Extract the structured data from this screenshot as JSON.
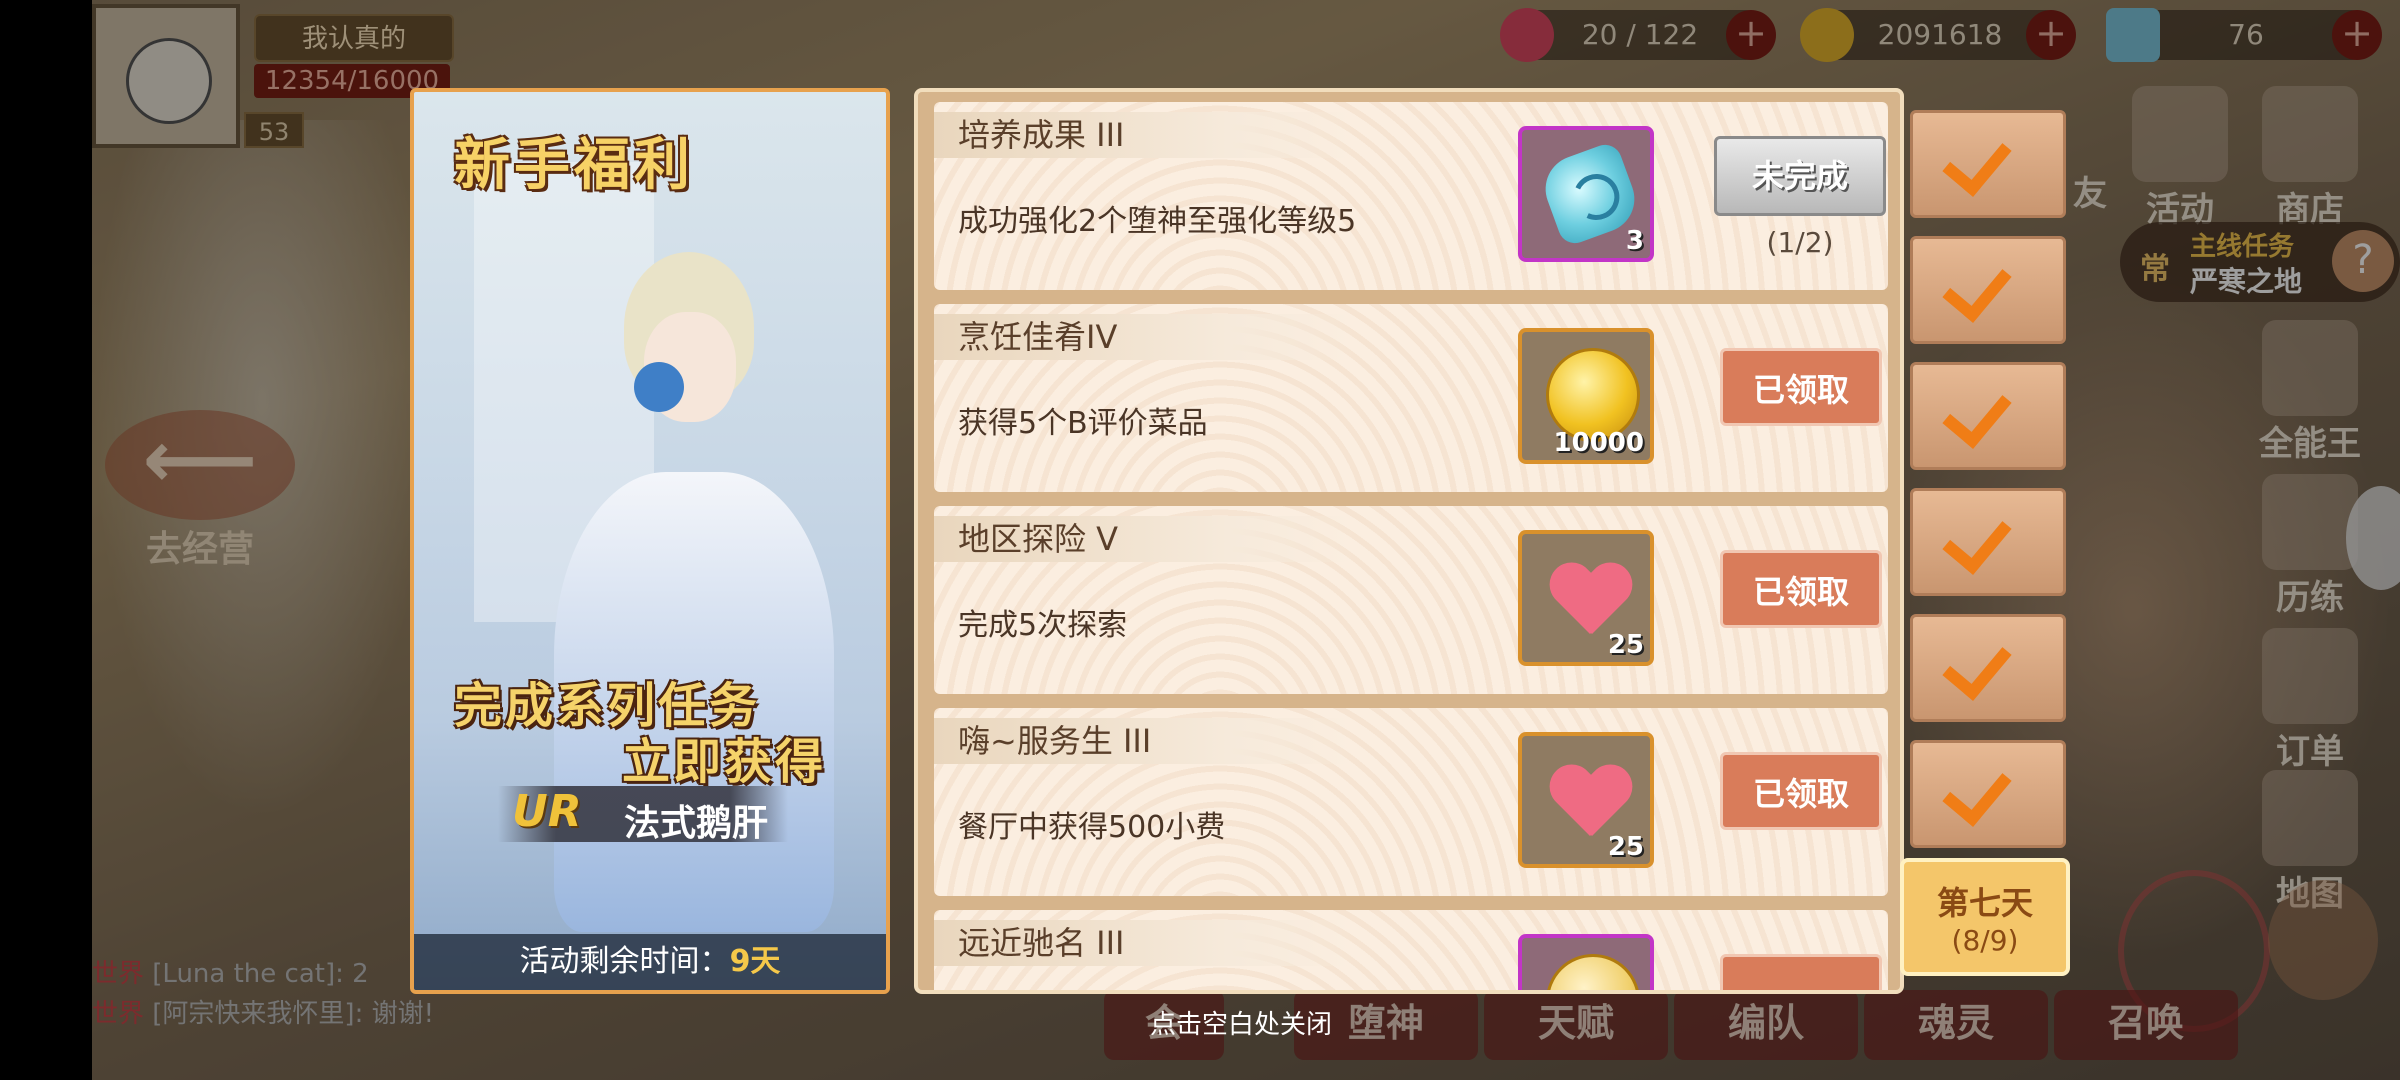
{
  "player": {
    "name": "我认真的",
    "exp": "12354/16000",
    "level": "53"
  },
  "resources": [
    {
      "name": "stamina",
      "icon": "heart-icon",
      "value": "20 / 122",
      "color": "#e0546e"
    },
    {
      "name": "gold",
      "icon": "coin-icon",
      "value": "2091618",
      "color": "#e8b82a"
    },
    {
      "name": "diamond",
      "icon": "diamond-icon",
      "value": "76",
      "color": "#8fd3e8"
    }
  ],
  "side_menu": [
    "友",
    "活动",
    "商店",
    "全能王",
    "历练",
    "订单",
    "地图"
  ],
  "quest_tag": {
    "line1": "主线任务",
    "line2": "严寒之地",
    "left": "常"
  },
  "left_banner": {
    "label": "去经营"
  },
  "chat": [
    {
      "channel": "世界",
      "text": "[Luna the cat]: 2"
    },
    {
      "channel": "世界",
      "text": "[阿宗快来我怀里]: 谢谢!"
    }
  ],
  "bottom_nav": [
    "会",
    "堕神",
    "天赋",
    "编队",
    "魂灵",
    "召唤"
  ],
  "promo": {
    "title": "新手福利",
    "line1": "完成系列任务",
    "line2": "立即获得",
    "ur": "UR",
    "reward_name": "法式鹅肝",
    "timer_label": "活动剩余时间：",
    "timer_value": "9天"
  },
  "tasks": [
    {
      "name": "培养成果 III",
      "desc": "成功强化2个堕神至强化等级5",
      "reward_icon": "gem-icon",
      "reward_count": "3",
      "status": "未完成",
      "progress": "(1/2)"
    },
    {
      "name": "烹饪佳肴IV",
      "desc": "获得5个B评价菜品",
      "reward_icon": "coin-icon",
      "reward_count": "10000",
      "status": "已领取",
      "progress": ""
    },
    {
      "name": "地区探险 V",
      "desc": "完成5次探索",
      "reward_icon": "heart-icon",
      "reward_count": "25",
      "status": "已领取",
      "progress": ""
    },
    {
      "name": "嗨~服务生 III",
      "desc": "餐厅中获得500小费",
      "reward_icon": "heart-icon",
      "reward_count": "25",
      "status": "已领取",
      "progress": ""
    },
    {
      "name": "远近驰名 III",
      "desc": "",
      "reward_icon": "item-icon",
      "reward_count": "",
      "status": "",
      "progress": ""
    }
  ],
  "day_tabs": {
    "completed_count": 6,
    "current": {
      "label": "第七天",
      "progress": "(8/9)"
    }
  },
  "close_hint": "点击空白处关闭"
}
